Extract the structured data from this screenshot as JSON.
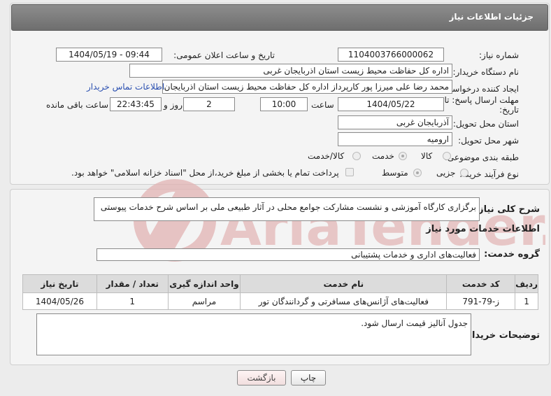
{
  "header": {
    "title": "جزئیات اطلاعات نیاز"
  },
  "fields": {
    "need_number_label": "شماره نیاز:",
    "need_number": "1104003766000062",
    "announce_label": "تاریخ و ساعت اعلان عمومی:",
    "announce_value": "1404/05/19 - 09:44",
    "buyer_org_label": "نام دستگاه خریدار:",
    "buyer_org": "اداره کل حفاظت محیط زیست استان اذربایجان غربی",
    "requester_label": "ایجاد کننده درخواست:",
    "requester": "محمد رضا علی میرزا پور کارپرداز اداره کل حفاظت محیط زیست استان اذربایجان",
    "contact_link": "اطلاعات تماس خریدار",
    "deadline_label_1": "مهلت ارسال پاسخ: تا",
    "deadline_label_2": "تاریخ:",
    "deadline_date": "1404/05/22",
    "time_label": "ساعت",
    "deadline_time": "10:00",
    "days_value": "2",
    "days_label": "روز و",
    "remaining_time": "22:43:45",
    "remaining_label": "ساعت باقی مانده",
    "province_label": "استان محل تحویل:",
    "province": "آذربایجان غربی",
    "city_label": "شهر محل تحویل:",
    "city": "ارومیه",
    "category_label": "طبقه بندی موضوعی:",
    "category_options": [
      "کالا",
      "خدمت",
      "کالا/خدمت"
    ],
    "process_label": "نوع فرآیند خرید :",
    "process_options": [
      "جزیی",
      "متوسط"
    ],
    "payment_note": "پرداخت تمام یا بخشی از مبلغ خرید،از محل \"اسناد خزانه اسلامی\" خواهد بود."
  },
  "description": {
    "label": "شرح کلی نیاز:",
    "value": "برگزاری کارگاه آموزشی و نشست مشارکت جوامع محلی در آثار طبیعی ملی بر اساس شرح خدمات پیوستی"
  },
  "services": {
    "section_title": "اطلاعات خدمات مورد نیاز",
    "group_label": "گروه خدمت:",
    "group_value": "فعالیت‌های اداری و خدمات پشتیبانی",
    "columns": [
      "ردیف",
      "کد خدمت",
      "نام خدمت",
      "واحد اندازه گیری",
      "تعداد / مقدار",
      "تاریخ نیاز"
    ],
    "rows": [
      {
        "row": "1",
        "code": "ز-79-791",
        "name": "فعالیت‌های آژانس‌های مسافرتی و گردانندگان تور",
        "unit": "مراسم",
        "qty": "1",
        "date": "1404/05/26"
      }
    ]
  },
  "buyer_notes": {
    "label": "توضیحات خریدار:",
    "value": "جدول آنالیز قیمت ارسال شود."
  },
  "buttons": {
    "print": "چاپ",
    "back": "بازگشت"
  },
  "watermark": {
    "text": "AriaTender.net"
  },
  "colors": {
    "title_bar": "#7a7a7a",
    "link": "#2a4fb0",
    "watermark": "#e2b3b3"
  }
}
